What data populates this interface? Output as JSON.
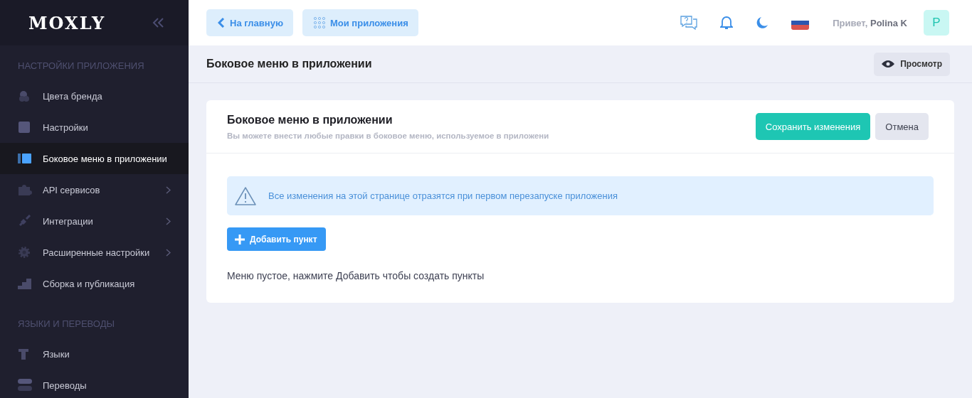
{
  "logo": "MOXLY",
  "sidebar": {
    "sections": [
      {
        "title": "НАСТРОЙКИ ПРИЛОЖЕНИЯ",
        "items": [
          {
            "label": "Цвета бренда",
            "kind": "palette",
            "selected": false,
            "has_submenu": false
          },
          {
            "label": "Настройки",
            "kind": "square",
            "selected": false,
            "has_submenu": false
          },
          {
            "label": "Боковое меню в приложении",
            "kind": "sidebar",
            "selected": true,
            "has_submenu": false
          },
          {
            "label": "API сервисов",
            "kind": "puzzle",
            "selected": false,
            "has_submenu": true
          },
          {
            "label": "Интеграции",
            "kind": "plug",
            "selected": false,
            "has_submenu": true
          },
          {
            "label": "Расширенные настройки",
            "kind": "gear",
            "selected": false,
            "has_submenu": true
          },
          {
            "label": "Сборка и публикация",
            "kind": "steps",
            "selected": false,
            "has_submenu": false
          }
        ]
      },
      {
        "title": "ЯЗЫКИ И ПЕРЕВОДЫ",
        "items": [
          {
            "label": "Языки",
            "kind": "type",
            "selected": false,
            "has_submenu": false
          },
          {
            "label": "Переводы",
            "kind": "toggles",
            "selected": false,
            "has_submenu": false
          }
        ]
      }
    ]
  },
  "topbar": {
    "buttons": [
      {
        "label": "На главную",
        "kind": "back"
      },
      {
        "label": "Мои приложения",
        "kind": "grid"
      }
    ],
    "greeting": "Привет,",
    "user": "Polina K",
    "avatar": "P"
  },
  "page_header": {
    "title": "Боковое меню в приложении",
    "preview_button": "Просмотр"
  },
  "card": {
    "title": "Боковое меню в приложении",
    "subtitle": "Вы можете внести любые правки в боковое меню, используемое в приложени",
    "save_button": "Сохранить изменения",
    "cancel_button": "Отмена",
    "alert": "Все изменения на этой странице отразятся при первом перезапуске приложения",
    "add_button": "Добавить пункт",
    "empty_text": "Меню пустое, нажмите Добавить чтобы создать пункты"
  }
}
